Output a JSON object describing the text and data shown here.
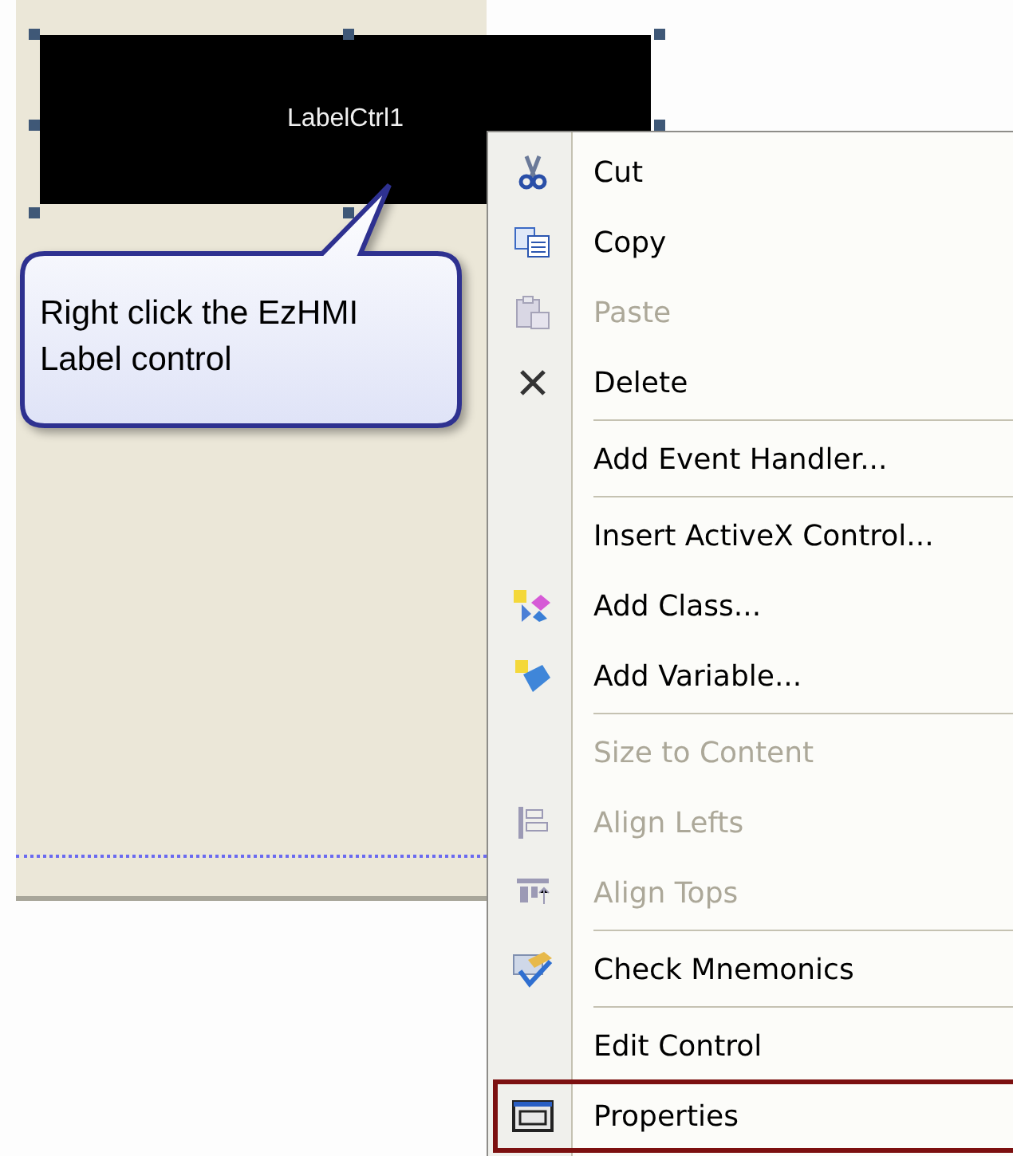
{
  "label_control": {
    "text": "LabelCtrl1"
  },
  "callout": {
    "text": "Right click the EzHMI Label control"
  },
  "context_menu": {
    "items": [
      {
        "kind": "item",
        "label": "Cut",
        "disabled": false,
        "highlighted": false
      },
      {
        "kind": "item",
        "label": "Copy",
        "disabled": false,
        "highlighted": false
      },
      {
        "kind": "item",
        "label": "Paste",
        "disabled": true,
        "highlighted": false
      },
      {
        "kind": "item",
        "label": "Delete",
        "disabled": false,
        "highlighted": false
      },
      {
        "kind": "separator"
      },
      {
        "kind": "item",
        "label": "Add Event Handler...",
        "disabled": false,
        "highlighted": false
      },
      {
        "kind": "separator"
      },
      {
        "kind": "item",
        "label": "Insert ActiveX Control...",
        "disabled": false,
        "highlighted": false
      },
      {
        "kind": "item",
        "label": "Add Class...",
        "disabled": false,
        "highlighted": false
      },
      {
        "kind": "item",
        "label": "Add Variable...",
        "disabled": false,
        "highlighted": false
      },
      {
        "kind": "separator"
      },
      {
        "kind": "item",
        "label": "Size to Content",
        "disabled": true,
        "highlighted": false
      },
      {
        "kind": "item",
        "label": "Align Lefts",
        "disabled": true,
        "highlighted": false
      },
      {
        "kind": "item",
        "label": "Align Tops",
        "disabled": true,
        "highlighted": false
      },
      {
        "kind": "separator"
      },
      {
        "kind": "item",
        "label": "Check Mnemonics",
        "disabled": false,
        "highlighted": false
      },
      {
        "kind": "separator"
      },
      {
        "kind": "item",
        "label": "Edit Control",
        "disabled": false,
        "highlighted": false
      },
      {
        "kind": "item",
        "label": "Properties",
        "disabled": false,
        "highlighted": true
      }
    ]
  }
}
